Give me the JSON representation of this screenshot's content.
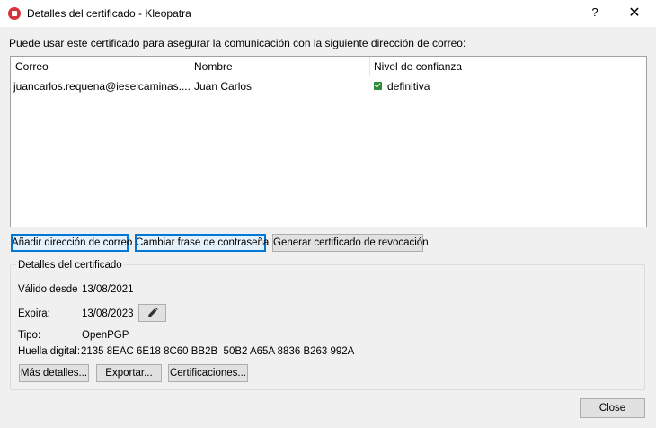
{
  "window": {
    "title": "Detalles del certificado - Kleopatra",
    "help_label": "?",
    "close_glyph": "✕",
    "app_icon": "kleopatra-icon"
  },
  "intro_text": "Puede usar este certificado para asegurar la comunicación con la siguiente dirección de correo:",
  "table": {
    "headers": [
      "Correo",
      "Nombre",
      "Nivel de confianza"
    ],
    "rows": [
      {
        "email": "juancarlos.requena@ieselcaminas....",
        "name": "Juan Carlos",
        "trust": "definitiva",
        "trust_icon": "check-icon",
        "trust_color": "#2e8b3a"
      }
    ]
  },
  "actions": {
    "add_email": "Añadir dirección de correo",
    "change_passphrase": "Cambiar frase de contraseña",
    "revocation": "Generar certificado de revocación"
  },
  "details": {
    "title": "Detalles del certificado",
    "valid_from_label": "Válido desde",
    "valid_from": "13/08/2021",
    "expires_label": "Expira:",
    "expires": "13/08/2023",
    "edit_icon": "pencil-icon",
    "type_label": "Tipo:",
    "type": "OpenPGP",
    "fingerprint_label": "Huella digital:",
    "fingerprint": "2135 8EAC 6E18 8C60 BB2B  50B2 A65A 8836 B263 992A",
    "more_details": "Más detalles...",
    "export": "Exportar...",
    "certifications": "Certificaciones..."
  },
  "footer": {
    "close": "Close"
  },
  "colors": {
    "focus_accent": "#0078d7",
    "background": "#f0f0f0"
  }
}
